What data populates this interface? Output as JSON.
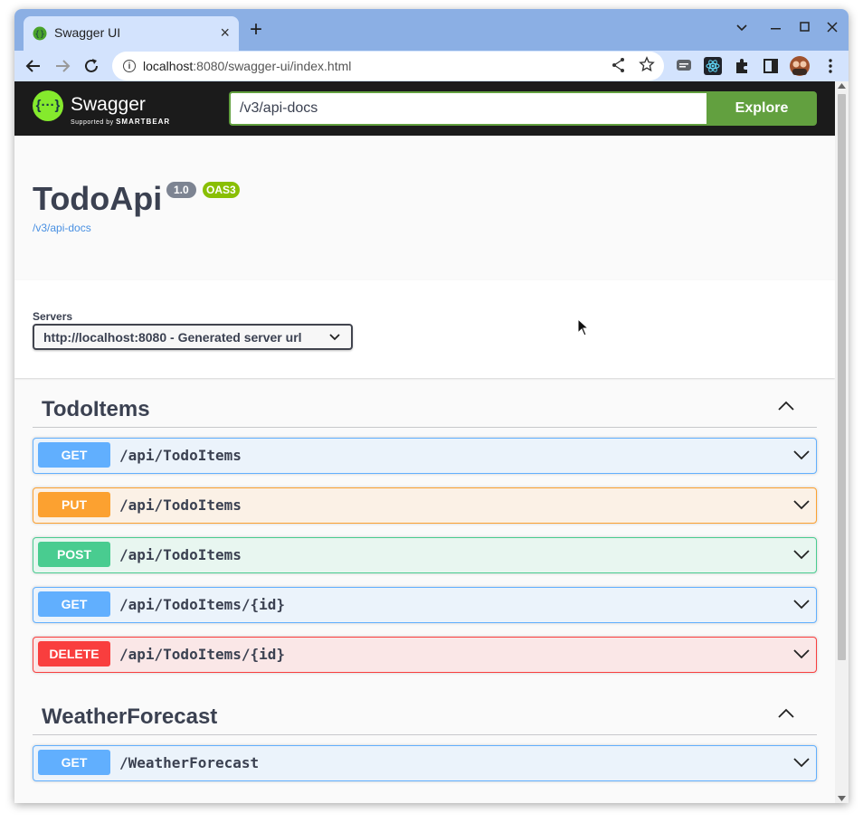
{
  "browser": {
    "tab_title": "Swagger UI",
    "tab_close": "×",
    "new_tab": "+",
    "url_host": "localhost",
    "url_path": ":8080/swagger-ui/index.html"
  },
  "header": {
    "logo_mark": "{···}",
    "logo_name": "Swagger",
    "logo_sub_prefix": "Supported by ",
    "logo_sub_brand": "SMARTBEAR",
    "spec_url": "/v3/api-docs",
    "explore_label": "Explore"
  },
  "info": {
    "title": "TodoApi",
    "version": "1.0",
    "oas_badge": "OAS3",
    "spec_link": "/v3/api-docs"
  },
  "servers": {
    "label": "Servers",
    "selected": "http://localhost:8080 - Generated server url"
  },
  "tags": [
    {
      "name": "TodoItems",
      "operations": [
        {
          "method": "GET",
          "path": "/api/TodoItems"
        },
        {
          "method": "PUT",
          "path": "/api/TodoItems"
        },
        {
          "method": "POST",
          "path": "/api/TodoItems"
        },
        {
          "method": "GET",
          "path": "/api/TodoItems/{id}"
        },
        {
          "method": "DELETE",
          "path": "/api/TodoItems/{id}"
        }
      ]
    },
    {
      "name": "WeatherForecast",
      "operations": [
        {
          "method": "GET",
          "path": "/WeatherForecast"
        }
      ]
    }
  ],
  "colors": {
    "get": "#61affe",
    "get_bg": "#ebf3fb",
    "put": "#fca130",
    "put_bg": "#fbf1e6",
    "post": "#49cc90",
    "post_bg": "#e8f6f0",
    "delete": "#f93e3e",
    "delete_bg": "#fae7e7",
    "accent": "#62a03f"
  }
}
